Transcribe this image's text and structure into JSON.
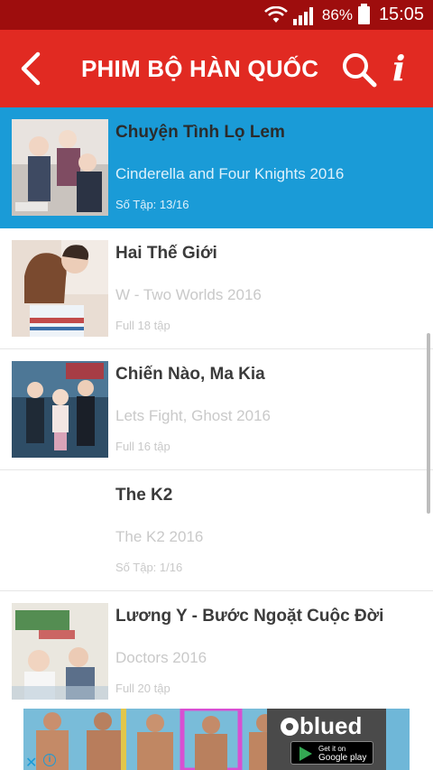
{
  "status_bar": {
    "wifi_icon": "wifi-icon",
    "signal_icon": "signal-icon",
    "battery_percent": "86%",
    "battery_icon": "battery-icon",
    "time": "15:05"
  },
  "app_bar": {
    "back_icon": "back-arrow-icon",
    "title": "PHIM BỘ HÀN QUỐC",
    "search_icon": "search-icon",
    "info_icon": "info-icon",
    "info_glyph": "i",
    "background_color": "#e12a22"
  },
  "list": {
    "selected_color": "#1a9bd7",
    "items": [
      {
        "title": "Chuyện Tình Lọ Lem",
        "subtitle": "Cinderella and Four Knights 2016",
        "episodes": "Số Tập: 13/16",
        "selected": true
      },
      {
        "title": "Hai Thế Giới",
        "subtitle": "W - Two Worlds 2016",
        "episodes": "Full 18 tập",
        "selected": false
      },
      {
        "title": "Chiến Nào, Ma Kia",
        "subtitle": "Lets Fight, Ghost 2016",
        "episodes": "Full 16 tập",
        "selected": false
      },
      {
        "title": "The K2",
        "subtitle": "The K2 2016",
        "episodes": "Số Tập: 1/16",
        "selected": false
      },
      {
        "title": "Lương Y - Bước Ngoặt Cuộc Đời",
        "subtitle": "Doctors 2016",
        "episodes": "Full 20 tập",
        "selected": false
      }
    ]
  },
  "ad": {
    "brand": "blued",
    "store_line1": "Get it on",
    "store_line2": "Google play",
    "close_glyph": "✕",
    "info_glyph": "i"
  }
}
